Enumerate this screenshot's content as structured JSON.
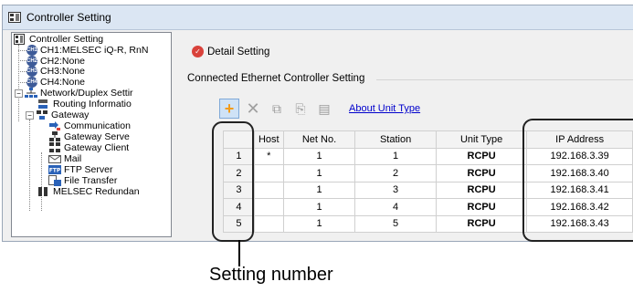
{
  "window": {
    "title": "Controller Setting"
  },
  "tree": {
    "items": [
      {
        "label": "Controller Setting"
      },
      {
        "label": "CH1:MELSEC iQ-R, RnN",
        "badge": "CH1"
      },
      {
        "label": "CH2:None",
        "badge": "CH2"
      },
      {
        "label": "CH3:None",
        "badge": "CH3"
      },
      {
        "label": "CH4:None",
        "badge": "CH4"
      },
      {
        "label": "Network/Duplex Settir"
      },
      {
        "label": "Routing Informatio"
      },
      {
        "label": "Gateway"
      },
      {
        "label": "Communication"
      },
      {
        "label": "Gateway Serve"
      },
      {
        "label": "Gateway Client"
      },
      {
        "label": "Mail"
      },
      {
        "label": "FTP Server"
      },
      {
        "label": "File Transfer"
      },
      {
        "label": "MELSEC Redundan"
      }
    ]
  },
  "detail": {
    "label": "Detail Setting"
  },
  "section": {
    "title": "Connected Ethernet Controller Setting"
  },
  "toolbar": {
    "about_link": "About Unit Type"
  },
  "grid": {
    "headers": [
      "Host",
      "Net No.",
      "Station",
      "Unit Type",
      "IP Address"
    ],
    "rows": [
      {
        "num": "1",
        "host": "*",
        "net": "1",
        "station": "1",
        "unit": "RCPU",
        "ip": "192.168.3.39"
      },
      {
        "num": "2",
        "host": "",
        "net": "1",
        "station": "2",
        "unit": "RCPU",
        "ip": "192.168.3.40"
      },
      {
        "num": "3",
        "host": "",
        "net": "1",
        "station": "3",
        "unit": "RCPU",
        "ip": "192.168.3.41"
      },
      {
        "num": "4",
        "host": "",
        "net": "1",
        "station": "4",
        "unit": "RCPU",
        "ip": "192.168.3.42"
      },
      {
        "num": "5",
        "host": "",
        "net": "1",
        "station": "5",
        "unit": "RCPU",
        "ip": "192.168.3.43"
      }
    ]
  },
  "callout": {
    "label": "Setting number"
  },
  "colors": {
    "accent": "#2a62b8",
    "detail_icon": "#d9423b",
    "add_icon": "#f29b1a",
    "link": "#0000cc"
  }
}
